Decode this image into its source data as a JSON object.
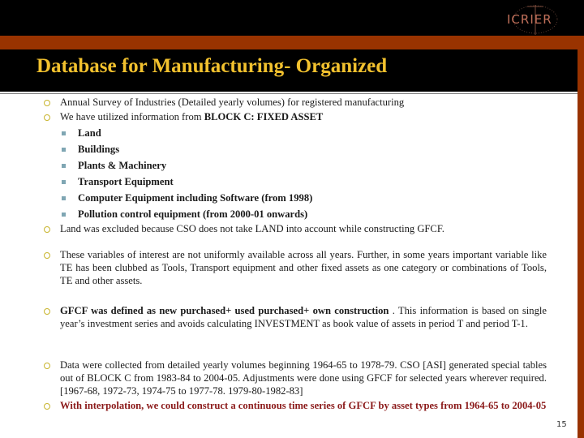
{
  "slide": {
    "title": "Database for Manufacturing- Organized",
    "logo_text": "ICRIER",
    "page_number": "15"
  },
  "bullets": [
    {
      "text": "Annual Survey of Industries (Detailed yearly volumes) for registered manufacturing"
    },
    {
      "text_prefix": "We have utilized information  from ",
      "text_bold": "BLOCK C: FIXED ASSET",
      "sub_items": [
        "Land",
        "Buildings",
        "Plants & Machinery",
        "Transport Equipment",
        "Computer Equipment including Software  (from 1998)",
        "Pollution control equipment  (from 2000-01 onwards)"
      ]
    },
    {
      "text": "Land was excluded  because CSO does not take LAND into account while constructing GFCF."
    },
    {
      "text": "These variables of interest are not uniformly available across all years.  Further, in some years important variable like TE  has been clubbed as Tools, Transport equipment and other fixed assets as one category or combinations of Tools, TE and other assets."
    },
    {
      "text_bold": "GFCF was defined as new purchased+ used purchased+ own construction",
      "text_rest": " . This information is based on single year’s investment series and avoids calculating INVESTMENT as book value of assets in period T and period T-1."
    },
    {
      "text": "Data were collected from detailed yearly volumes beginning 1964-65 to 1978-79. CSO [ASI] generated special tables out of BLOCK C from 1983-84 to 2004-05.  Adjustments were done using GFCF for selected years wherever required.[1967-68, 1972-73, 1974-75 to 1977-78. 1979-80-1982-83]"
    },
    {
      "text": "With interpolation, we could construct a continuous time series  of GFCF by asset types from 1964-65 to 2004-05"
    }
  ],
  "colors": {
    "title": "#f2c12e",
    "accent_bar": "#993300",
    "bullet_ring": "#c8b42c",
    "sub_bullet": "#7fa6b3",
    "highlight_text": "#8b1a1a"
  }
}
